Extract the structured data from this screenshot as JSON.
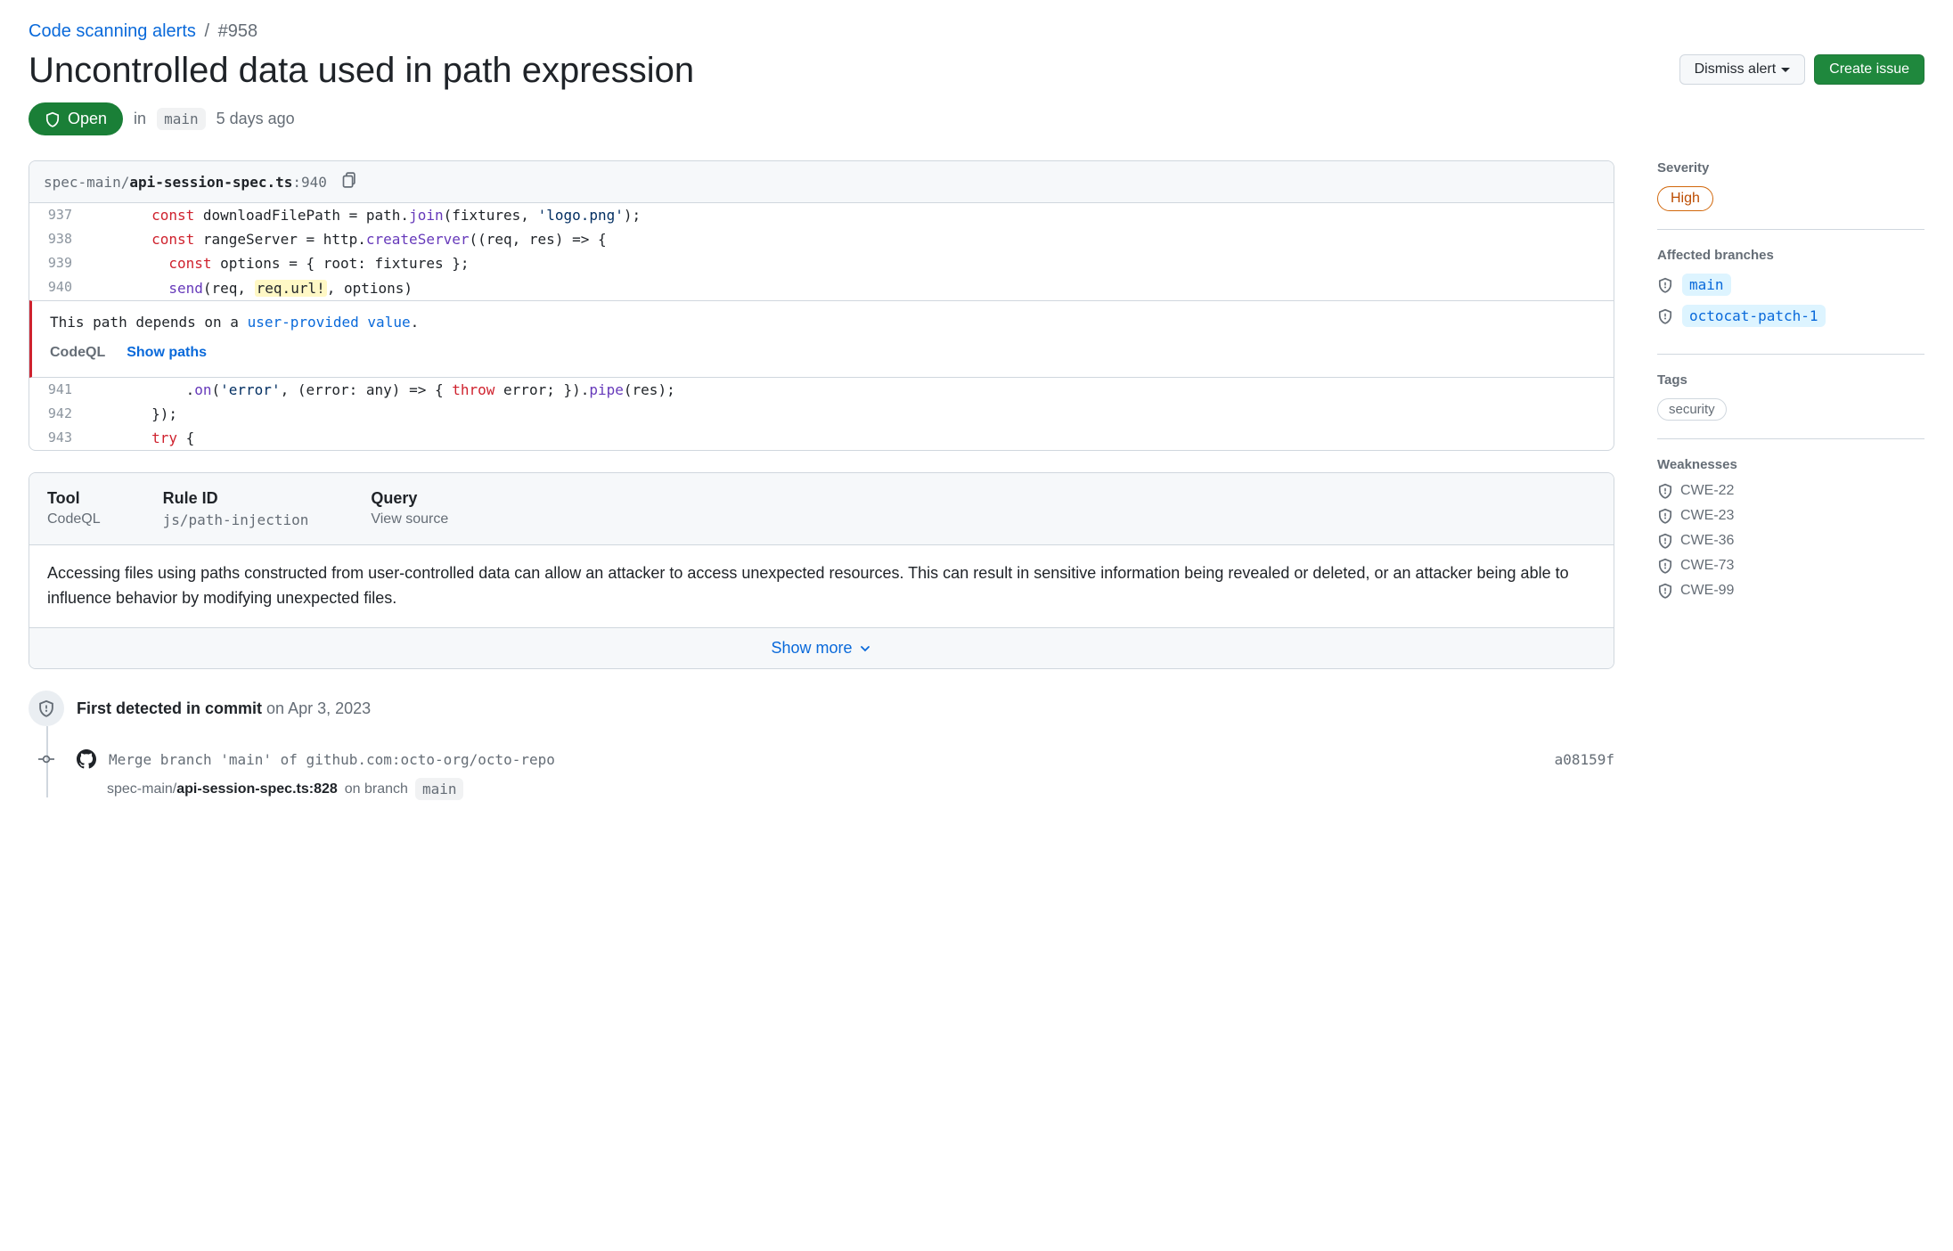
{
  "breadcrumb": {
    "parent": "Code scanning alerts",
    "sep": "/",
    "id": "#958"
  },
  "title": "Uncontrolled data used in path expression",
  "actions": {
    "dismiss": "Dismiss alert",
    "create_issue": "Create issue"
  },
  "status": {
    "state": "Open",
    "in": "in",
    "branch": "main",
    "ago": "5 days ago"
  },
  "codebox": {
    "path_dir": "spec-main/",
    "path_file": "api-session-spec.ts",
    "path_line": ":940",
    "note_text": "This path depends on a ",
    "note_link": "user-provided value",
    "note_after": ".",
    "tool_label": "CodeQL",
    "show_paths": "Show paths",
    "lines": {
      "937": "937",
      "938": "938",
      "939": "939",
      "940": "940",
      "941": "941",
      "942": "942",
      "943": "943"
    },
    "l937": {
      "kw": "const",
      "var": " downloadFilePath = path.",
      "fn": "join",
      "rest1": "(fixtures, ",
      "str": "'logo.png'",
      "rest2": ");"
    },
    "l938": {
      "kw": "const",
      "var": " rangeServer = http.",
      "fn": "createServer",
      "rest": "((req, res) => {"
    },
    "l939": {
      "kw": "const",
      "rest": " options = { root: fixtures };"
    },
    "l940": {
      "fn": "send",
      "rest1": "(req, ",
      "hl": "req.url!",
      "rest2": ", options)"
    },
    "l941": {
      "fn1": "on",
      "rest1": "(",
      "str": "'error'",
      "rest2": ", (error: any) => { ",
      "kw": "throw",
      "rest3": " error; }).",
      "fn2": "pipe",
      "rest4": "(res);"
    },
    "l942": {
      "rest": "});"
    },
    "l943": {
      "kw": "try",
      "rest": " {"
    }
  },
  "infobox": {
    "tool_h": "Tool",
    "tool_v": "CodeQL",
    "rule_h": "Rule ID",
    "rule_v": "js/path-injection",
    "query_h": "Query",
    "query_v": "View source",
    "body": "Accessing files using paths constructed from user-controlled data can allow an attacker to access unexpected resources. This can result in sensitive information being revealed or deleted, or an attacker being able to influence behavior by modifying unexpected files.",
    "show_more": "Show more"
  },
  "timeline": {
    "heading_b": "First detected in commit",
    "heading_date": " on Apr 3, 2023",
    "commit_msg": "Merge branch 'main' of github.com:octo-org/octo-repo",
    "commit_sha": "a08159f",
    "sub_dir": "spec-main/",
    "sub_file": "api-session-spec.ts:828",
    "sub_on": " on branch ",
    "sub_branch": "main"
  },
  "sidebar": {
    "severity_h": "Severity",
    "severity_v": "High",
    "branches_h": "Affected branches",
    "branches": {
      "0": "main",
      "1": "octocat-patch-1"
    },
    "tags_h": "Tags",
    "tag": "security",
    "weak_h": "Weaknesses",
    "weak": {
      "0": "CWE-22",
      "1": "CWE-23",
      "2": "CWE-36",
      "3": "CWE-73",
      "4": "CWE-99"
    }
  }
}
